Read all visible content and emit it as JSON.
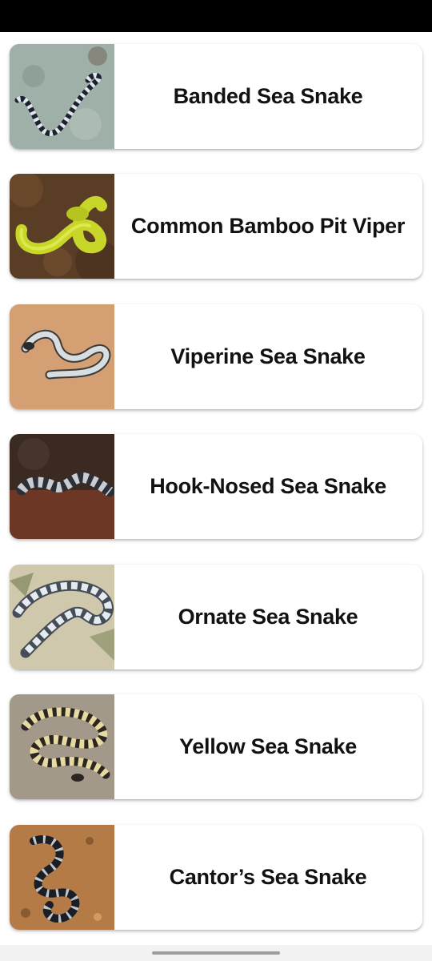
{
  "snakes": [
    {
      "name": "Banded Sea Snake",
      "image": "banded-sea-snake-photo"
    },
    {
      "name": "Common Bamboo Pit Viper",
      "image": "bamboo-pit-viper-photo"
    },
    {
      "name": "Viperine Sea Snake",
      "image": "viperine-sea-snake-photo"
    },
    {
      "name": "Hook-Nosed Sea Snake",
      "image": "hook-nosed-sea-snake-photo"
    },
    {
      "name": "Ornate Sea Snake",
      "image": "ornate-sea-snake-photo"
    },
    {
      "name": "Yellow Sea Snake",
      "image": "yellow-sea-snake-photo"
    },
    {
      "name": "Cantor’s Sea Snake",
      "image": "cantors-sea-snake-photo"
    }
  ],
  "colors": {
    "status_bar": "#000000",
    "card_background": "#ffffff",
    "title_text": "#111111"
  }
}
